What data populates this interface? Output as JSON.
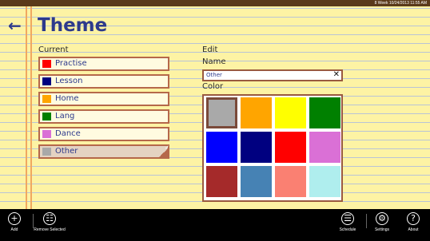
{
  "system_bar": {
    "text": "8 Week 10/24/2013 11:55 AM"
  },
  "header": {
    "back_icon": "back-arrow-icon",
    "title": "Theme"
  },
  "current": {
    "label": "Current",
    "items": [
      {
        "name": "Practise",
        "color": "#ff0000",
        "selected": false
      },
      {
        "name": "Lesson",
        "color": "#000080",
        "selected": false
      },
      {
        "name": "Home",
        "color": "#ffa500",
        "selected": false
      },
      {
        "name": "Lang",
        "color": "#008000",
        "selected": false
      },
      {
        "name": "Dance",
        "color": "#da70d6",
        "selected": false
      },
      {
        "name": "Other",
        "color": "#a9a9a9",
        "selected": true
      }
    ]
  },
  "edit": {
    "label": "Edit",
    "name_label": "Name",
    "name_value": "Other",
    "clear_icon": "close-icon",
    "color_label": "Color",
    "colors": [
      "#a9a9a9",
      "#ffa500",
      "#ffff00",
      "#008000",
      "#0000ff",
      "#000080",
      "#ff0000",
      "#da70d6",
      "#a52a2a",
      "#4682b4",
      "#fa8072",
      "#afeeee"
    ],
    "selected_color": "#a9a9a9"
  },
  "appbar": {
    "left": [
      {
        "label": "Add",
        "icon": "plus-icon"
      },
      {
        "label": "Remove Selected",
        "icon": "trash-icon"
      }
    ],
    "right": [
      {
        "label": "Schedule",
        "icon": "schedule-list-icon"
      },
      {
        "label": "Settings",
        "icon": "gear-icon"
      },
      {
        "label": "About",
        "icon": "question-icon"
      }
    ]
  }
}
